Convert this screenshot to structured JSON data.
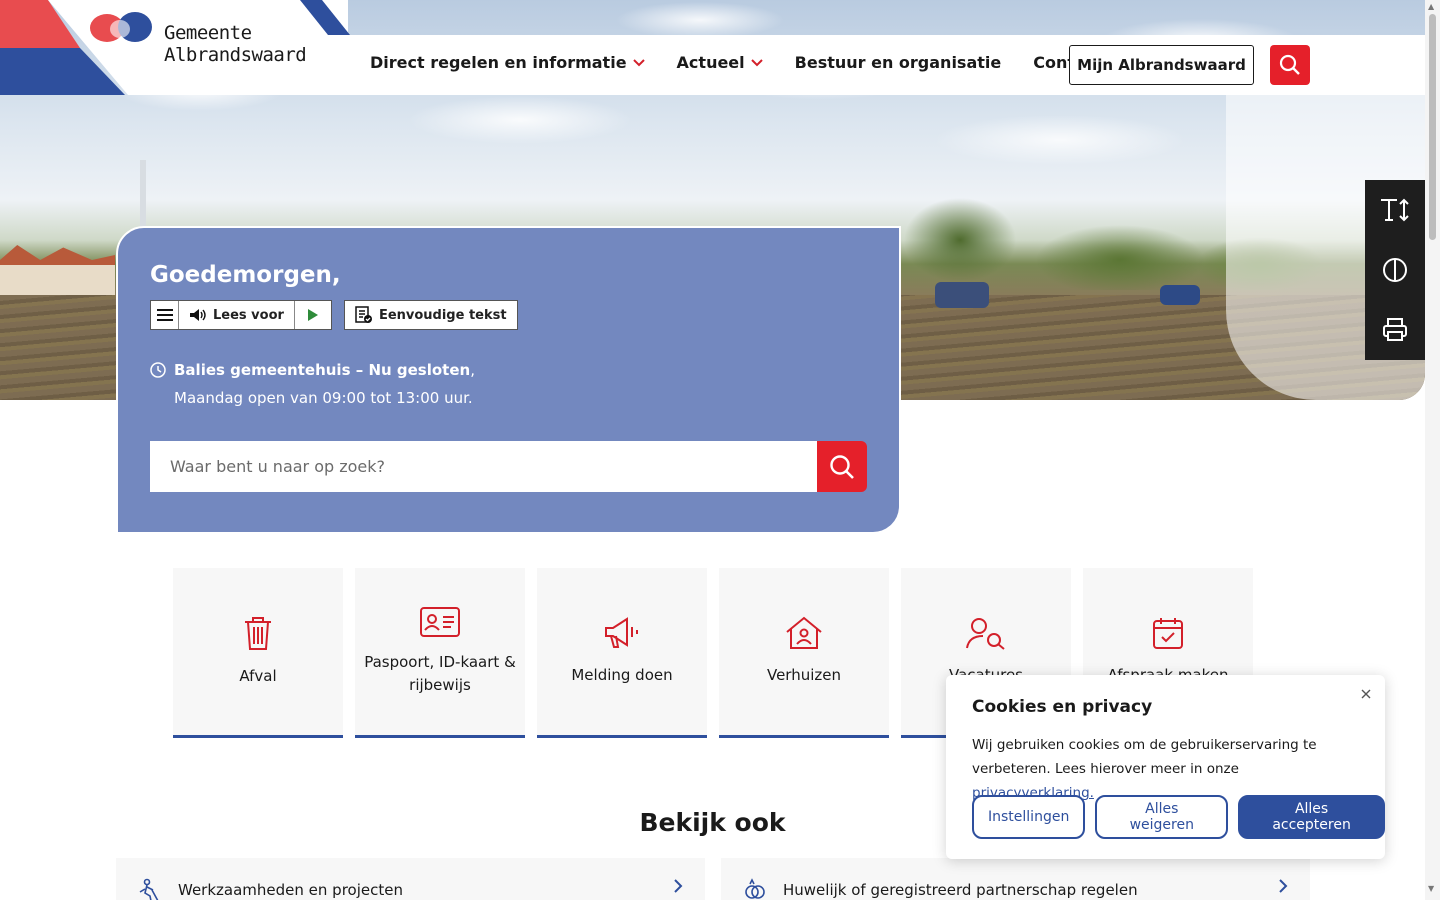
{
  "logo": {
    "line1": "Gemeente",
    "line2": "Albrandswaard"
  },
  "nav": {
    "items": [
      {
        "label": "Direct regelen en informatie",
        "dropdown": true
      },
      {
        "label": "Actueel",
        "dropdown": true
      },
      {
        "label": "Bestuur en organisatie",
        "dropdown": false
      },
      {
        "label": "Contact",
        "dropdown": false
      }
    ],
    "mijn_label": "Mijn Albrandswaard"
  },
  "hero": {
    "greeting": "Goedemorgen,",
    "read_label": "Lees voor",
    "simple_text_label": "Eenvoudige tekst",
    "hours_bold": "Balies gemeentehuis – Nu gesloten",
    "hours_comma": ",",
    "hours_line2": "Maandag open van 09:00 tot 13:00 uur.",
    "search_placeholder": "Waar bent u naar op zoek?"
  },
  "tiles": [
    {
      "label": "Afval",
      "icon": "trash-icon"
    },
    {
      "label": "Paspoort, ID-kaart & rijbewijs",
      "icon": "id-card-icon"
    },
    {
      "label": "Melding doen",
      "icon": "megaphone-icon"
    },
    {
      "label": "Verhuizen",
      "icon": "house-icon"
    },
    {
      "label": "Vacatures",
      "icon": "person-search-icon"
    },
    {
      "label": "Afspraak maken",
      "icon": "calendar-icon"
    }
  ],
  "section": {
    "title": "Bekijk ook"
  },
  "links": [
    {
      "label": "Werkzaamheden en projecten",
      "icon": "worker-icon"
    },
    {
      "label": "Huwelijk of geregistreerd partnerschap regelen",
      "icon": "rings-icon"
    }
  ],
  "cookie": {
    "title": "Cookies en privacy",
    "body": "Wij gebruiken cookies om de gebruikerservaring te verbeteren. Lees hierover meer in onze ",
    "link": "privacyverklaring.",
    "settings": "Instellingen",
    "reject": "Alles weigeren",
    "accept": "Alles accepteren"
  },
  "colors": {
    "brand_red": "#e5202a",
    "brand_blue": "#2e4f9d",
    "card_blue": "#7388bf"
  }
}
